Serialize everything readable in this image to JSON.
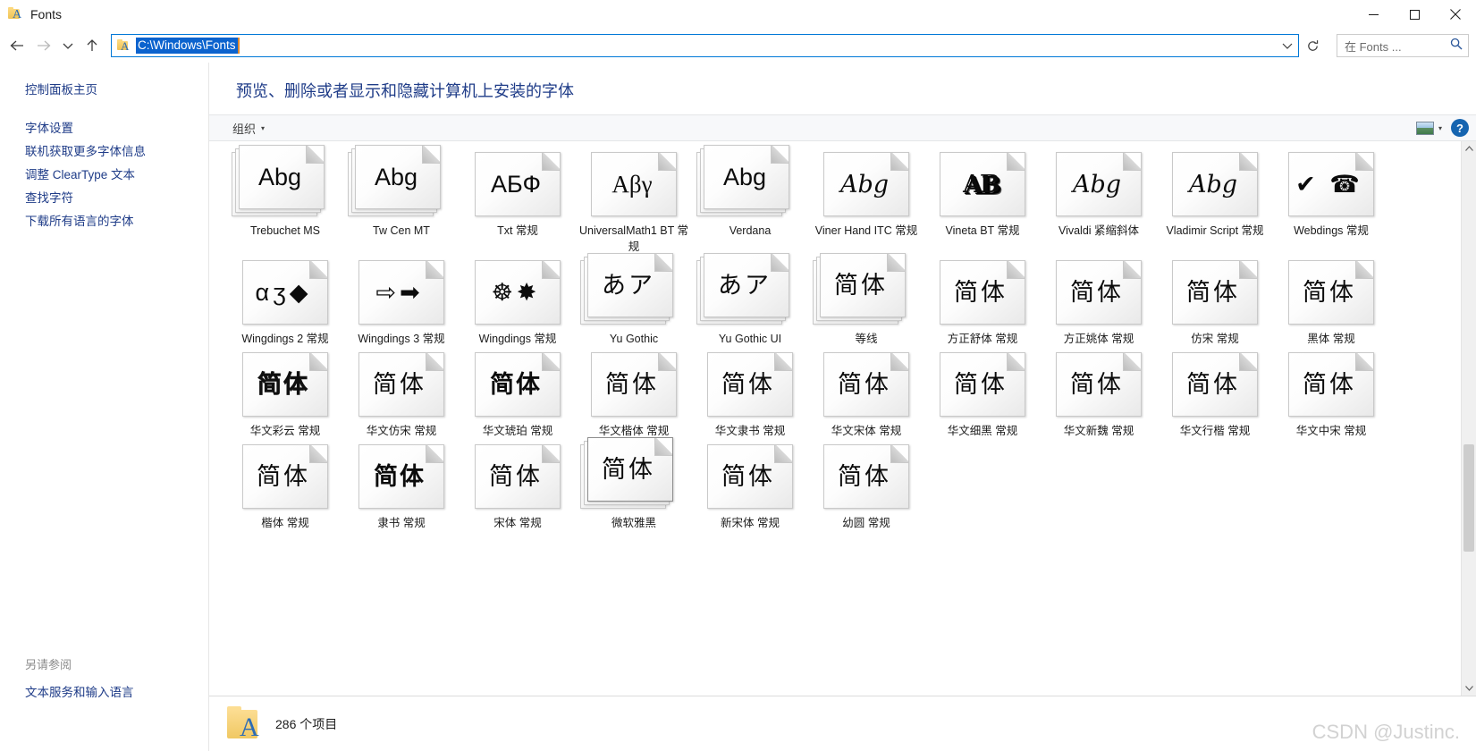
{
  "window": {
    "title": "Fonts",
    "icon": "fonts-folder-icon",
    "minimize_label": "─",
    "maximize_label": "□",
    "close_label": "✕"
  },
  "address_bar": {
    "back_label": "←",
    "forward_label": "→",
    "history_label": "⌄",
    "up_label": "↑",
    "path": "C:\\Windows\\Fonts",
    "dropdown_label": "⌄",
    "refresh_label": "↻"
  },
  "search": {
    "placeholder": "在 Fonts ...",
    "icon": "search-icon"
  },
  "sidebar": {
    "items": [
      {
        "label": "控制面板主页"
      },
      {
        "label": "字体设置"
      },
      {
        "label": "联机获取更多字体信息"
      },
      {
        "label": "调整 ClearType 文本"
      },
      {
        "label": "查找字符"
      },
      {
        "label": "下载所有语言的字体"
      }
    ],
    "see_also_heading": "另请参阅",
    "see_also_items": [
      {
        "label": "文本服务和输入语言"
      }
    ]
  },
  "content": {
    "heading": "预览、删除或者显示和隐藏计算机上安装的字体",
    "toolbar": {
      "organize_label": "组织",
      "caret": "▾",
      "view_icon": "view-thumbnail-icon",
      "view_caret": "▾",
      "help_label": "?"
    }
  },
  "fonts": {
    "rows": [
      [
        {
          "name": "Trebuchet MS",
          "glyph": "Abg",
          "style": "g-sans",
          "stacked": true,
          "selected": false
        },
        {
          "name": "Tw Cen MT",
          "glyph": "Abg",
          "style": "g-sans",
          "stacked": true,
          "selected": false
        },
        {
          "name": "Txt 常规",
          "glyph": "АБФ",
          "style": "g-light",
          "stacked": false,
          "selected": false
        },
        {
          "name": "UniversalMath1 BT 常规",
          "glyph": "Αβγ",
          "style": "g-serif",
          "stacked": false,
          "selected": false
        },
        {
          "name": "Verdana",
          "glyph": "Abg",
          "style": "g-sans g-big",
          "stacked": true,
          "selected": false
        },
        {
          "name": "Viner Hand ITC 常规",
          "glyph": "Abg",
          "style": "g-script",
          "stacked": false,
          "selected": false
        },
        {
          "name": "Vineta BT 常规",
          "glyph": "AB",
          "style": "g-shadow",
          "stacked": false,
          "selected": false
        },
        {
          "name": "Vivaldi 紧缩斜体",
          "glyph": "Abg",
          "style": "g-script",
          "stacked": false,
          "selected": false
        },
        {
          "name": "Vladimir Script 常规",
          "glyph": "Abg",
          "style": "g-script",
          "stacked": false,
          "selected": false
        },
        {
          "name": "Webdings 常规",
          "glyph": "✔ ☎",
          "style": "g-dingbat",
          "stacked": false,
          "selected": false
        }
      ],
      [
        {
          "name": "Wingdings 2 常规",
          "glyph": "αʒ◆",
          "style": "g-dingbat",
          "stacked": false,
          "selected": false
        },
        {
          "name": "Wingdings 3 常规",
          "glyph": "⇨➡",
          "style": "g-dingbat",
          "stacked": false,
          "selected": false
        },
        {
          "name": "Wingdings 常规",
          "glyph": "☸✸",
          "style": "g-dingbat",
          "stacked": false,
          "selected": false
        },
        {
          "name": "Yu Gothic",
          "glyph": "あア",
          "style": "g-cjk-serif",
          "stacked": true,
          "selected": false
        },
        {
          "name": "Yu Gothic UI",
          "glyph": "あア",
          "style": "g-cjk-serif",
          "stacked": true,
          "selected": false
        },
        {
          "name": "等线",
          "glyph": "简体",
          "style": "g-cjk",
          "stacked": true,
          "selected": false
        },
        {
          "name": "方正舒体 常规",
          "glyph": "简体",
          "style": "g-cjk-serif",
          "stacked": false,
          "selected": false
        },
        {
          "name": "方正姚体 常规",
          "glyph": "简体",
          "style": "g-cjk",
          "stacked": false,
          "selected": false
        },
        {
          "name": "仿宋 常规",
          "glyph": "简体",
          "style": "g-cjk-serif",
          "stacked": false,
          "selected": false
        },
        {
          "name": "黑体 常规",
          "glyph": "简体",
          "style": "g-cjk",
          "stacked": false,
          "selected": false
        }
      ],
      [
        {
          "name": "华文彩云 常规",
          "glyph": "简体",
          "style": "g-cjk-outline",
          "stacked": false,
          "selected": false
        },
        {
          "name": "华文仿宋 常规",
          "glyph": "简体",
          "style": "g-cjk-serif",
          "stacked": false,
          "selected": false
        },
        {
          "name": "华文琥珀 常规",
          "glyph": "简体",
          "style": "g-cjk-bold",
          "stacked": false,
          "selected": false
        },
        {
          "name": "华文楷体 常规",
          "glyph": "简体",
          "style": "g-cjk-serif",
          "stacked": false,
          "selected": false
        },
        {
          "name": "华文隶书 常规",
          "glyph": "简体",
          "style": "g-cjk",
          "stacked": false,
          "selected": false
        },
        {
          "name": "华文宋体 常规",
          "glyph": "简体",
          "style": "g-cjk-serif",
          "stacked": false,
          "selected": false
        },
        {
          "name": "华文细黑 常规",
          "glyph": "简体",
          "style": "g-cjk",
          "stacked": false,
          "selected": false
        },
        {
          "name": "华文新魏 常规",
          "glyph": "简体",
          "style": "g-cjk",
          "stacked": false,
          "selected": false
        },
        {
          "name": "华文行楷 常规",
          "glyph": "简体",
          "style": "g-cjk-serif",
          "stacked": false,
          "selected": false
        },
        {
          "name": "华文中宋 常规",
          "glyph": "简体",
          "style": "g-cjk-serif",
          "stacked": false,
          "selected": false
        }
      ],
      [
        {
          "name": "楷体 常规",
          "glyph": "简体",
          "style": "g-cjk-serif",
          "stacked": false,
          "selected": false
        },
        {
          "name": "隶书 常规",
          "glyph": "简体",
          "style": "g-cjk-bold",
          "stacked": false,
          "selected": false
        },
        {
          "name": "宋体 常规",
          "glyph": "简体",
          "style": "g-cjk-serif",
          "stacked": false,
          "selected": false
        },
        {
          "name": "微软雅黑",
          "glyph": "简体",
          "style": "g-cjk",
          "stacked": true,
          "selected": true
        },
        {
          "name": "新宋体 常规",
          "glyph": "简体",
          "style": "g-cjk-serif",
          "stacked": false,
          "selected": false
        },
        {
          "name": "幼圆 常规",
          "glyph": "简体",
          "style": "g-cjk",
          "stacked": false,
          "selected": false
        }
      ]
    ]
  },
  "statusbar": {
    "item_count_text": "286 个项目",
    "folder_icon": "fonts-folder-icon"
  },
  "watermark": {
    "text": "CSDN @Justinc."
  },
  "colors": {
    "link": "#1f3c88",
    "heading": "#1f3c88",
    "address_selection": "#0b63ce",
    "accent": "#0078d7",
    "help_blue": "#1564b0"
  }
}
